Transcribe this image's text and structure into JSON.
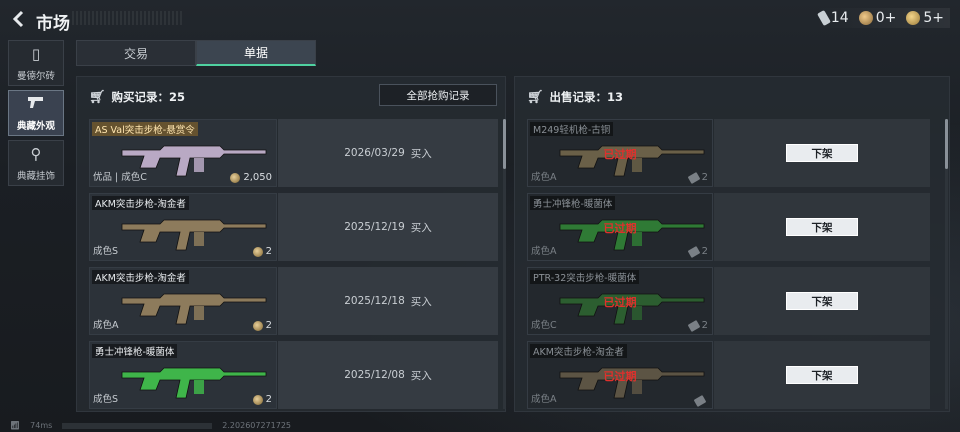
{
  "header": {
    "title": "市场",
    "back_icon": "back-arrow-icon"
  },
  "currencies": [
    {
      "icon": "card-icon",
      "value": "14"
    },
    {
      "icon": "coin-icon",
      "value": "0+"
    },
    {
      "icon": "gold-coin-icon",
      "value": "5+"
    }
  ],
  "sidebar": {
    "items": [
      {
        "label": "曼德尔砖",
        "icon": "brick-icon",
        "active": false
      },
      {
        "label": "典藏外观",
        "icon": "pistol-icon",
        "active": true
      },
      {
        "label": "典藏挂饰",
        "icon": "charm-icon",
        "active": false
      }
    ]
  },
  "tabs": [
    {
      "label": "交易",
      "active": false
    },
    {
      "label": "单据",
      "active": true
    }
  ],
  "purchase": {
    "title": "购买记录：25",
    "all_button": "全部抢购记录",
    "rows": [
      {
        "name": "AS Val突击步枪-悬赏令",
        "quality": "优品 | 成色C",
        "price": "2,050",
        "date": "2026/03/29",
        "action": "买入",
        "gun_color": "#b9a9c4"
      },
      {
        "name": "AKM突击步枪-淘金者",
        "quality": "成色S",
        "price": "2",
        "date": "2025/12/19",
        "action": "买入",
        "gun_color": "#8d7b5c"
      },
      {
        "name": "AKM突击步枪-淘金者",
        "quality": "成色A",
        "price": "2",
        "date": "2025/12/18",
        "action": "买入",
        "gun_color": "#8d7b5c"
      },
      {
        "name": "勇士冲锋枪-暖菌体",
        "quality": "成色S",
        "price": "2",
        "date": "2025/12/08",
        "action": "买入",
        "gun_color": "#3fb54a"
      }
    ]
  },
  "sale": {
    "title": "出售记录：13",
    "rows": [
      {
        "name": "M249轻机枪-古铜",
        "quality": "成色A",
        "price": "2",
        "status": "已过期",
        "button": "下架",
        "gun_color": "#6a6048"
      },
      {
        "name": "勇士冲锋枪-暖菌体",
        "quality": "成色A",
        "price": "2",
        "status": "已过期",
        "button": "下架",
        "gun_color": "#2f7a35"
      },
      {
        "name": "PTR-32突击步枪-暖菌体",
        "quality": "成色C",
        "price": "2",
        "status": "已过期",
        "button": "下架",
        "gun_color": "#2c5e30"
      },
      {
        "name": "AKM突击步枪-淘金者",
        "quality": "成色A",
        "price": "",
        "status": "已过期",
        "button": "下架",
        "gun_color": "#5c5444"
      }
    ]
  },
  "status_bar": {
    "ping": "74ms",
    "version": "2.202607271725"
  },
  "colors": {
    "accent": "#4fd1a0",
    "expired": "#e0302c"
  }
}
